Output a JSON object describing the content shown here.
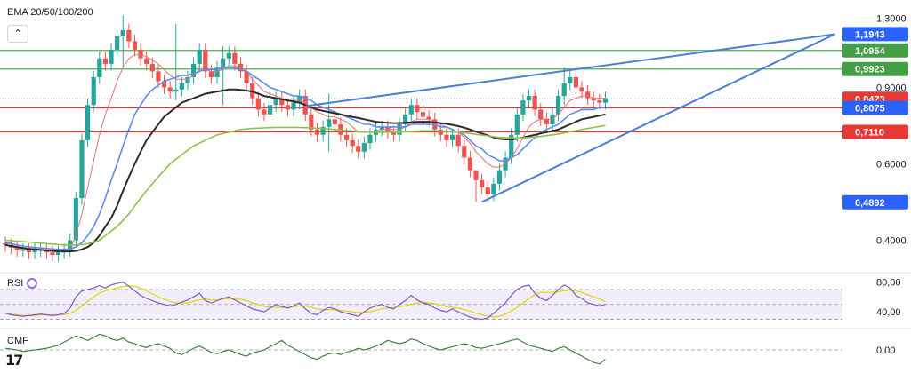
{
  "indicator_title": "EMA 20/50/100/200",
  "collapse_icon": "chevron-up-icon",
  "rsi_label": "RSI",
  "cmf_label": "CMF",
  "logo_text": "17",
  "colors": {
    "up": "#26a69a",
    "down": "#ef5350",
    "ema20": "#e57373",
    "ema50": "#5b8def",
    "ema100": "#2b2b2b",
    "ema200": "#8bc34a",
    "trend": "#4a7fd6",
    "resistance": "#4caf50",
    "support": "#e53935",
    "rsi": "#7e57c2",
    "rsi_ma": "#d8d800",
    "cmf": "#2e7d32"
  },
  "chart_data": [
    {
      "type": "candlestick",
      "panel": "price",
      "y_ticks": [
        "1,3000",
        "0,9000",
        "0,6000",
        "0,4000"
      ],
      "y_tick_values": [
        1.3,
        0.9,
        0.6,
        0.4
      ],
      "ylim": [
        0.34,
        1.34
      ],
      "scale": "log",
      "horizontal_levels": [
        {
          "value": 1.0954,
          "label": "1,0954",
          "kind": "resistance"
        },
        {
          "value": 0.9923,
          "label": "0,9923",
          "kind": "resistance"
        },
        {
          "value": 0.8075,
          "label": "0,8075",
          "kind": "support"
        },
        {
          "value": 0.711,
          "label": "0,7110",
          "kind": "support"
        }
      ],
      "price_tags": [
        {
          "value": 1.1943,
          "label": "1,1943",
          "color": "#2962ff"
        },
        {
          "value": 1.0954,
          "label": "1,0954",
          "color": "#43a047"
        },
        {
          "value": 0.9923,
          "label": "0,9923",
          "color": "#43a047"
        },
        {
          "value": 0.8473,
          "label": "0,8473",
          "color": "#e53935"
        },
        {
          "value": 0.8075,
          "label": "0,8075",
          "color": "#2962ff"
        },
        {
          "value": 0.711,
          "label": "0,7110",
          "color": "#e53935"
        },
        {
          "value": 0.4892,
          "label": "0,4892",
          "color": "#2962ff"
        }
      ],
      "closes": [
        0.39,
        0.385,
        0.38,
        0.38,
        0.375,
        0.38,
        0.38,
        0.375,
        0.37,
        0.375,
        0.38,
        0.4,
        0.5,
        0.68,
        0.82,
        0.95,
        1.05,
        1.02,
        1.1,
        1.18,
        1.22,
        1.15,
        1.1,
        1.05,
        1.02,
        0.98,
        0.93,
        0.9,
        0.88,
        0.89,
        0.92,
        0.95,
        1.02,
        1.1,
        0.98,
        0.95,
        1.0,
        1.05,
        1.08,
        1.02,
        0.98,
        0.92,
        0.85,
        0.8,
        0.78,
        0.82,
        0.85,
        0.82,
        0.8,
        0.83,
        0.86,
        0.78,
        0.72,
        0.7,
        0.73,
        0.76,
        0.74,
        0.7,
        0.68,
        0.66,
        0.64,
        0.67,
        0.7,
        0.72,
        0.73,
        0.71,
        0.7,
        0.74,
        0.78,
        0.82,
        0.79,
        0.77,
        0.76,
        0.72,
        0.7,
        0.68,
        0.7,
        0.66,
        0.62,
        0.58,
        0.55,
        0.53,
        0.51,
        0.54,
        0.58,
        0.62,
        0.7,
        0.78,
        0.84,
        0.86,
        0.8,
        0.76,
        0.74,
        0.78,
        0.86,
        0.92,
        0.95,
        0.9,
        0.88,
        0.85,
        0.84,
        0.83,
        0.85
      ],
      "wicks": [
        {
          "i": 20,
          "hi": 1.32,
          "lo": 1.0
        },
        {
          "i": 29,
          "hi": 1.26,
          "lo": 0.84
        },
        {
          "i": 37,
          "hi": 1.12,
          "lo": 0.82
        },
        {
          "i": 45,
          "hi": 0.88,
          "lo": 0.78
        },
        {
          "i": 55,
          "hi": 0.87,
          "lo": 0.64
        },
        {
          "i": 80,
          "hi": 0.56,
          "lo": 0.49
        },
        {
          "i": 95,
          "hi": 1.0,
          "lo": 0.82
        }
      ],
      "emas": {
        "ema20": [
          0.39,
          0.387,
          0.383,
          0.382,
          0.38,
          0.38,
          0.38,
          0.379,
          0.377,
          0.377,
          0.378,
          0.382,
          0.41,
          0.46,
          0.53,
          0.61,
          0.7,
          0.78,
          0.85,
          0.93,
          1.0,
          1.05,
          1.07,
          1.07,
          1.06,
          1.04,
          1.02,
          0.99,
          0.96,
          0.94,
          0.94,
          0.94,
          0.96,
          0.99,
          0.99,
          0.98,
          0.98,
          0.99,
          1.01,
          1.01,
          1.0,
          0.98,
          0.94,
          0.91,
          0.88,
          0.87,
          0.86,
          0.85,
          0.84,
          0.84,
          0.84,
          0.83,
          0.81,
          0.79,
          0.78,
          0.77,
          0.77,
          0.76,
          0.75,
          0.73,
          0.71,
          0.71,
          0.71,
          0.71,
          0.72,
          0.72,
          0.72,
          0.72,
          0.73,
          0.75,
          0.76,
          0.76,
          0.76,
          0.75,
          0.74,
          0.73,
          0.72,
          0.71,
          0.69,
          0.67,
          0.64,
          0.62,
          0.6,
          0.59,
          0.59,
          0.6,
          0.62,
          0.65,
          0.69,
          0.73,
          0.75,
          0.76,
          0.76,
          0.76,
          0.78,
          0.81,
          0.84,
          0.85,
          0.86,
          0.86,
          0.85,
          0.85,
          0.85
        ],
        "ema50": [
          0.395,
          0.393,
          0.39,
          0.388,
          0.386,
          0.385,
          0.384,
          0.383,
          0.382,
          0.381,
          0.381,
          0.382,
          0.386,
          0.395,
          0.41,
          0.43,
          0.46,
          0.5,
          0.55,
          0.6,
          0.66,
          0.72,
          0.78,
          0.82,
          0.86,
          0.89,
          0.91,
          0.93,
          0.94,
          0.95,
          0.96,
          0.96,
          0.97,
          0.98,
          0.99,
          0.99,
          0.99,
          1.0,
          1.0,
          1.0,
          0.99,
          0.98,
          0.96,
          0.94,
          0.92,
          0.9,
          0.89,
          0.88,
          0.87,
          0.86,
          0.86,
          0.85,
          0.84,
          0.82,
          0.81,
          0.8,
          0.79,
          0.78,
          0.77,
          0.76,
          0.75,
          0.74,
          0.74,
          0.73,
          0.73,
          0.73,
          0.73,
          0.73,
          0.73,
          0.74,
          0.74,
          0.74,
          0.74,
          0.74,
          0.73,
          0.73,
          0.72,
          0.71,
          0.7,
          0.68,
          0.66,
          0.65,
          0.63,
          0.62,
          0.61,
          0.61,
          0.62,
          0.63,
          0.65,
          0.67,
          0.69,
          0.71,
          0.72,
          0.73,
          0.74,
          0.76,
          0.78,
          0.79,
          0.8,
          0.8,
          0.8,
          0.81,
          0.81
        ],
        "ema100": [
          0.39,
          0.388,
          0.386,
          0.384,
          0.382,
          0.381,
          0.38,
          0.379,
          0.378,
          0.377,
          0.377,
          0.377,
          0.378,
          0.381,
          0.386,
          0.395,
          0.41,
          0.43,
          0.45,
          0.48,
          0.52,
          0.56,
          0.6,
          0.64,
          0.68,
          0.71,
          0.74,
          0.77,
          0.79,
          0.81,
          0.83,
          0.84,
          0.85,
          0.86,
          0.87,
          0.875,
          0.88,
          0.885,
          0.89,
          0.89,
          0.888,
          0.885,
          0.88,
          0.87,
          0.86,
          0.855,
          0.85,
          0.845,
          0.84,
          0.835,
          0.83,
          0.82,
          0.81,
          0.8,
          0.795,
          0.79,
          0.785,
          0.78,
          0.775,
          0.77,
          0.765,
          0.76,
          0.755,
          0.75,
          0.748,
          0.746,
          0.745,
          0.745,
          0.746,
          0.748,
          0.75,
          0.75,
          0.75,
          0.748,
          0.745,
          0.742,
          0.738,
          0.733,
          0.727,
          0.72,
          0.712,
          0.705,
          0.698,
          0.69,
          0.685,
          0.683,
          0.683,
          0.685,
          0.69,
          0.695,
          0.7,
          0.705,
          0.71,
          0.715,
          0.72,
          0.73,
          0.74,
          0.75,
          0.76,
          0.765,
          0.77,
          0.775,
          0.78
        ],
        "ema200": [
          0.4,
          0.399,
          0.398,
          0.397,
          0.396,
          0.395,
          0.394,
          0.393,
          0.392,
          0.391,
          0.39,
          0.39,
          0.39,
          0.391,
          0.393,
          0.396,
          0.4,
          0.41,
          0.42,
          0.43,
          0.445,
          0.46,
          0.48,
          0.5,
          0.52,
          0.54,
          0.56,
          0.58,
          0.6,
          0.615,
          0.63,
          0.645,
          0.66,
          0.67,
          0.68,
          0.69,
          0.7,
          0.705,
          0.71,
          0.715,
          0.72,
          0.722,
          0.724,
          0.725,
          0.726,
          0.727,
          0.728,
          0.728,
          0.728,
          0.728,
          0.728,
          0.727,
          0.726,
          0.725,
          0.724,
          0.722,
          0.72,
          0.718,
          0.716,
          0.714,
          0.712,
          0.711,
          0.71,
          0.71,
          0.71,
          0.71,
          0.71,
          0.711,
          0.712,
          0.713,
          0.714,
          0.715,
          0.715,
          0.715,
          0.714,
          0.713,
          0.712,
          0.71,
          0.708,
          0.705,
          0.702,
          0.699,
          0.696,
          0.693,
          0.69,
          0.689,
          0.688,
          0.688,
          0.689,
          0.69,
          0.692,
          0.694,
          0.697,
          0.7,
          0.703,
          0.707,
          0.711,
          0.715,
          0.72,
          0.724,
          0.728,
          0.732,
          0.736
        ]
      },
      "trendlines": [
        {
          "from": [
            51,
            0.815
          ],
          "to": [
            141,
            1.194
          ]
        },
        {
          "from": [
            81,
            0.49
          ],
          "to": [
            141,
            1.194
          ]
        }
      ]
    },
    {
      "type": "line",
      "panel": "rsi",
      "title": "RSI",
      "y_ticks": [
        "80,00",
        "40,00"
      ],
      "y_tick_values": [
        80,
        40
      ],
      "ylim": [
        20,
        90
      ],
      "band": [
        30,
        70
      ],
      "rsi": [
        38,
        36,
        35,
        34,
        35,
        36,
        37,
        36,
        35,
        36,
        38,
        45,
        60,
        68,
        70,
        72,
        75,
        72,
        76,
        78,
        80,
        74,
        68,
        62,
        58,
        55,
        52,
        50,
        48,
        50,
        53,
        56,
        60,
        65,
        55,
        52,
        55,
        58,
        60,
        56,
        52,
        48,
        44,
        42,
        40,
        45,
        50,
        47,
        45,
        48,
        52,
        44,
        38,
        36,
        42,
        46,
        44,
        40,
        38,
        36,
        34,
        40,
        45,
        48,
        50,
        46,
        44,
        50,
        55,
        62,
        56,
        52,
        50,
        45,
        42,
        40,
        44,
        40,
        36,
        33,
        31,
        30,
        32,
        38,
        45,
        52,
        62,
        70,
        74,
        76,
        65,
        58,
        55,
        62,
        70,
        76,
        72,
        62,
        58,
        52,
        50,
        48,
        50
      ],
      "rsi_ma": [
        38,
        37,
        36,
        35,
        35,
        35,
        36,
        36,
        36,
        36,
        36,
        38,
        42,
        48,
        54,
        60,
        65,
        68,
        70,
        72,
        74,
        75,
        74,
        72,
        68,
        64,
        60,
        57,
        54,
        52,
        52,
        52,
        54,
        56,
        57,
        56,
        56,
        57,
        58,
        58,
        57,
        55,
        52,
        50,
        47,
        46,
        46,
        46,
        46,
        47,
        48,
        48,
        46,
        44,
        43,
        43,
        43,
        42,
        41,
        40,
        39,
        39,
        40,
        42,
        44,
        45,
        46,
        47,
        48,
        50,
        52,
        53,
        52,
        51,
        49,
        47,
        46,
        45,
        43,
        41,
        38,
        36,
        34,
        33,
        34,
        37,
        41,
        46,
        52,
        58,
        63,
        66,
        66,
        66,
        67,
        68,
        69,
        68,
        66,
        63,
        60,
        57,
        54
      ]
    },
    {
      "type": "line",
      "panel": "cmf",
      "title": "CMF",
      "y_ticks": [
        "0,00"
      ],
      "y_tick_values": [
        0
      ],
      "ylim": [
        -0.25,
        0.25
      ],
      "cmf": [
        0.02,
        0.01,
        0.0,
        -0.02,
        -0.01,
        0.0,
        0.01,
        0.02,
        0.04,
        0.06,
        0.1,
        0.14,
        0.18,
        0.15,
        0.12,
        0.16,
        0.2,
        0.18,
        0.14,
        0.12,
        0.15,
        0.1,
        0.08,
        0.05,
        0.03,
        0.06,
        0.08,
        0.05,
        0.02,
        -0.04,
        -0.06,
        -0.02,
        0.02,
        0.05,
        0.01,
        -0.03,
        -0.05,
        -0.02,
        0.0,
        -0.03,
        -0.06,
        -0.08,
        -0.04,
        -0.02,
        0.0,
        0.04,
        0.08,
        0.12,
        0.06,
        0.02,
        -0.02,
        -0.06,
        -0.1,
        -0.12,
        -0.08,
        -0.05,
        -0.04,
        -0.06,
        -0.03,
        -0.01,
        0.02,
        0.0,
        0.02,
        0.05,
        0.08,
        0.12,
        0.1,
        0.08,
        0.1,
        0.14,
        0.12,
        0.08,
        0.05,
        0.02,
        0.0,
        0.02,
        0.04,
        0.06,
        0.08,
        0.06,
        0.03,
        0.02,
        0.04,
        0.06,
        0.08,
        0.1,
        0.12,
        0.14,
        0.1,
        0.06,
        0.04,
        0.02,
        0.0,
        -0.02,
        0.02,
        0.04,
        0.0,
        -0.04,
        -0.08,
        -0.12,
        -0.16,
        -0.18,
        -0.12
      ]
    }
  ]
}
